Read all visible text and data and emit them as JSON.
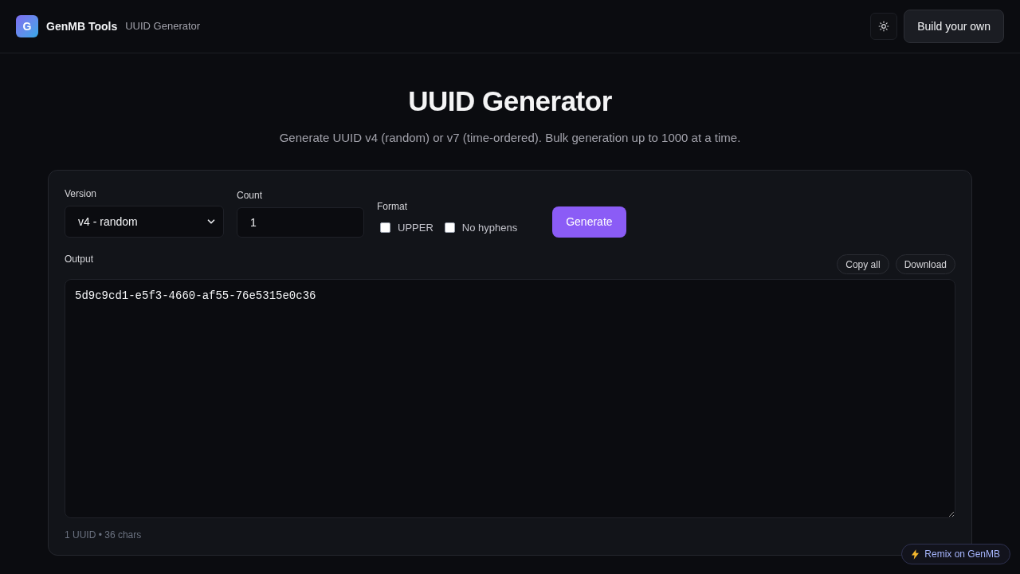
{
  "header": {
    "logo_letter": "G",
    "brand": "GenMB Tools",
    "page": "UUID Generator",
    "build_button": "Build your own"
  },
  "title": "UUID Generator",
  "subtitle": "Generate UUID v4 (random) or v7 (time-ordered). Bulk generation up to 1000 at a time.",
  "form": {
    "version": {
      "label": "Version",
      "value": "v4 - random"
    },
    "count": {
      "label": "Count",
      "value": "1"
    },
    "format": {
      "label": "Format",
      "options": [
        {
          "label": "UPPER",
          "checked": false
        },
        {
          "label": "No hyphens",
          "checked": false
        }
      ]
    },
    "generate_button": "Generate"
  },
  "output": {
    "label": "Output",
    "actions": [
      "Copy all",
      "Download"
    ],
    "value": "5d9c9cd1-e5f3-4660-af55-76e5315e0c36",
    "summary": "1 UUID • 36 chars"
  },
  "remix_badge": "Remix on GenMB"
}
